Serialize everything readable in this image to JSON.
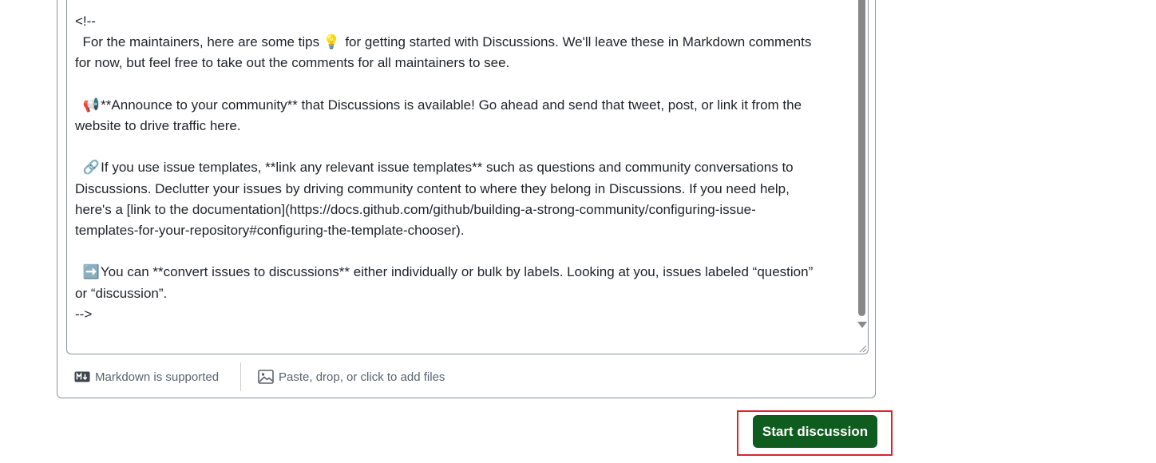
{
  "editor": {
    "lines": [
      {
        "text": "<!--"
      },
      {
        "text": "  For the maintainers, here are some tips ",
        "emoji": "💡",
        "after": "  for getting started with Discussions. We'll leave these in Markdown comments"
      },
      {
        "text": "for now, but feel free to take out the comments for all maintainers to see."
      },
      {
        "blank": true
      },
      {
        "prefix": "  ",
        "emoji": "📢",
        "text": " **Announce to your community** that Discussions is available! Go ahead and send that tweet, post, or link it from the"
      },
      {
        "text": "website to drive traffic here."
      },
      {
        "blank": true
      },
      {
        "prefix": "  ",
        "emoji": "🔗",
        "text": " If you use issue templates, **link any relevant issue templates** such as questions and community conversations to"
      },
      {
        "text": "Discussions. Declutter your issues by driving community content to where they belong in Discussions. If you need help,"
      },
      {
        "text": "here's a [link to the documentation](https://docs.github.com/github/building-a-strong-community/configuring-issue-"
      },
      {
        "text": "templates-for-your-repository#configuring-the-template-chooser)."
      },
      {
        "blank": true
      },
      {
        "prefix": "  ",
        "emoji": "➡️",
        "text": " You can **convert issues to discussions** either individually or bulk by labels. Looking at you, issues labeled “question”"
      },
      {
        "text": "or “discussion”."
      },
      {
        "text": "-->"
      }
    ]
  },
  "footer": {
    "markdown_label": "Markdown is supported",
    "markdown_icon": "markdown-icon",
    "files_label": "Paste, drop, or click to add files",
    "files_icon": "image-icon"
  },
  "actions": {
    "start_label": "Start discussion"
  },
  "colors": {
    "primary_button": "#0f5d1e",
    "highlight": "#d9262b",
    "muted_text": "#59636e"
  }
}
